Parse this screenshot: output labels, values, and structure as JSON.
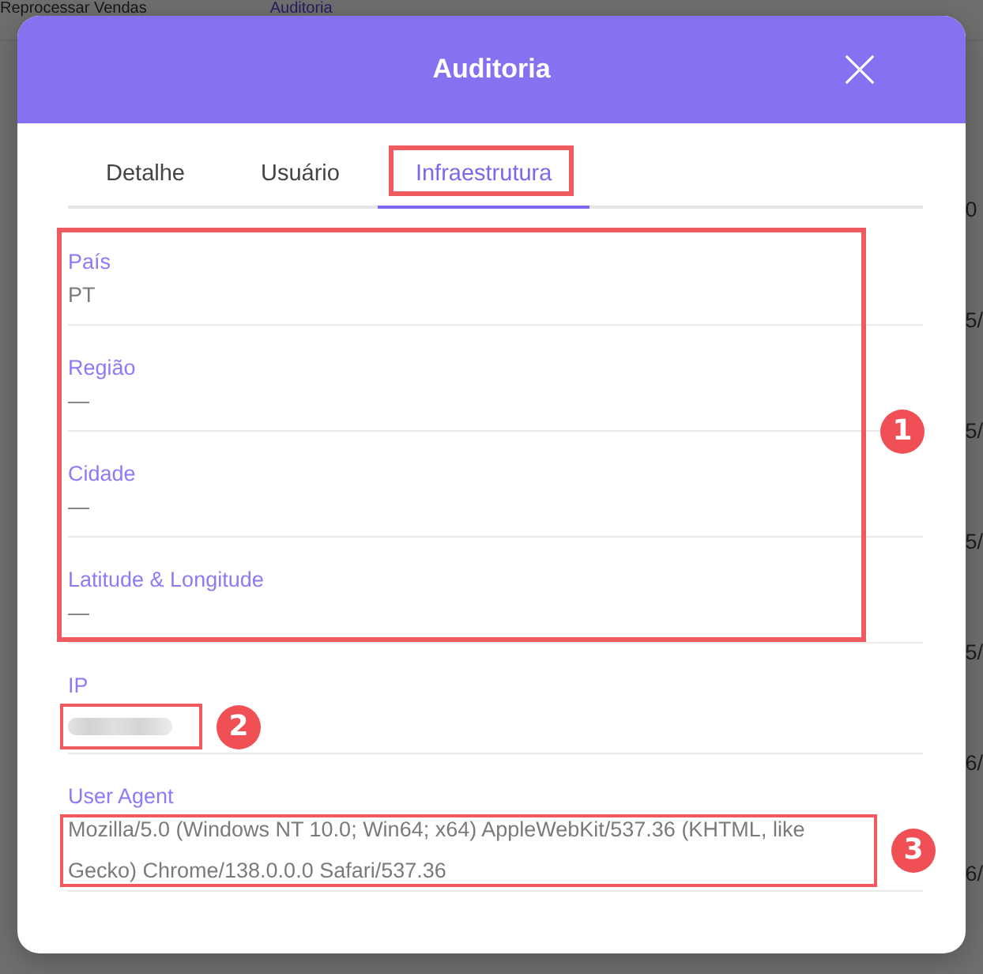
{
  "backdrop": {
    "nav": [
      {
        "label": "Reprocessar Vendas",
        "selected": false
      },
      {
        "label": "Auditoria",
        "selected": true
      }
    ],
    "column_edge": [
      "0",
      "5/",
      "5/",
      "5/",
      "5/",
      "6/",
      "6/"
    ]
  },
  "dialog": {
    "title": "Auditoria"
  },
  "tabs": [
    {
      "label": "Detalhe",
      "selected": false,
      "highlighted": false
    },
    {
      "label": "Usuário",
      "selected": false,
      "highlighted": false
    },
    {
      "label": "Infraestrutura",
      "selected": true,
      "highlighted": true
    }
  ],
  "groups": [
    {
      "marker": "1",
      "kind": "group_frame",
      "fields": [
        {
          "label": "País",
          "value": "PT",
          "redacted": false
        },
        {
          "label": "Região",
          "value": "—",
          "redacted": false
        },
        {
          "label": "Cidade",
          "value": "—",
          "redacted": false
        },
        {
          "label": "Latitude & Longitude",
          "value": "—",
          "redacted": false
        }
      ]
    },
    {
      "marker": "2",
      "kind": "value_frame",
      "fields": [
        {
          "label": "IP",
          "redacted": true
        }
      ]
    },
    {
      "marker": "3",
      "kind": "value_frame",
      "fields": [
        {
          "label": "User Agent",
          "value": "Mozilla/5.0 (Windows NT 10.0; Win64; x64) AppleWebKit/537.36 (KHTML, like Gecko) Chrome/138.0.0.0 Safari/537.36",
          "redacted": false
        }
      ]
    }
  ]
}
